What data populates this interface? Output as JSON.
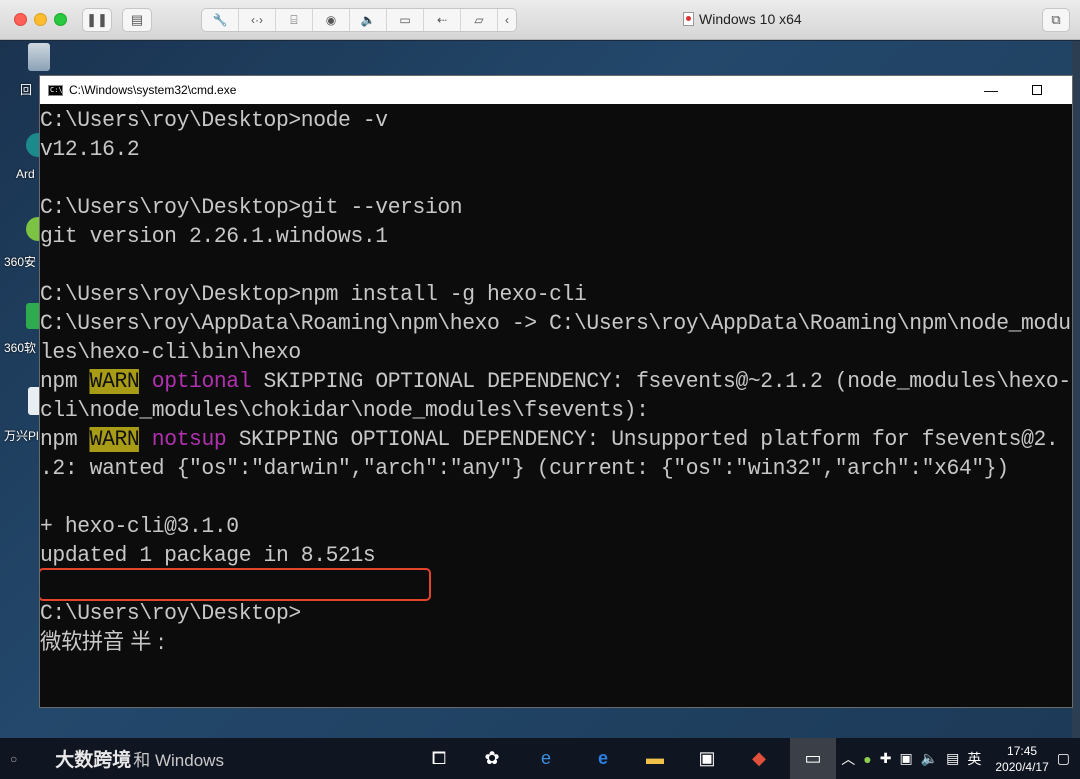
{
  "mac": {
    "title": "Windows 10 x64",
    "toolbar_icons": [
      "wrench-icon",
      "code-icon",
      "drive-icon",
      "camera-icon",
      "speaker-icon",
      "video-icon",
      "usb-icon",
      "folder-share-icon",
      "chevron-left-icon"
    ]
  },
  "desktop": {
    "icons": [
      {
        "label": "回",
        "icon": "recycle-bin-icon"
      },
      {
        "label": "Ard",
        "icon": "arduino-shortcut-icon"
      },
      {
        "label": "360安",
        "icon": "360-safe-shortcut-icon"
      },
      {
        "label": "360软",
        "icon": "360-software-shortcut-icon"
      },
      {
        "label": "万兴Pl",
        "icon": "wondershare-shortcut-icon"
      }
    ]
  },
  "cmd": {
    "title": "C:\\Windows\\system32\\cmd.exe",
    "lines": [
      "C:\\Users\\roy\\Desktop>node -v",
      "v12.16.2",
      "",
      "C:\\Users\\roy\\Desktop>git --version",
      "git version 2.26.1.windows.1",
      "",
      "C:\\Users\\roy\\Desktop>npm install -g hexo-cli",
      "C:\\Users\\roy\\AppData\\Roaming\\npm\\hexo -> C:\\Users\\roy\\AppData\\Roaming\\npm\\node_modu",
      "les\\hexo-cli\\bin\\hexo"
    ],
    "warn1": {
      "prefix": "npm ",
      "tag": "WARN",
      "level": "optional",
      "msg": " SKIPPING OPTIONAL DEPENDENCY: fsevents@~2.1.2 (node_modules\\hexo-"
    },
    "warn1_cont": "cli\\node_modules\\chokidar\\node_modules\\fsevents):",
    "warn2": {
      "prefix": "npm ",
      "tag": "WARN",
      "level": "notsup",
      "msg": " SKIPPING OPTIONAL DEPENDENCY: Unsupported platform for fsevents@2."
    },
    "warn2_cont": ".2: wanted {\"os\":\"darwin\",\"arch\":\"any\"} (current: {\"os\":\"win32\",\"arch\":\"x64\"})",
    "tail": [
      "",
      "+ hexo-cli@3.1.0",
      "updated 1 package in 8.521s",
      "",
      "C:\\Users\\roy\\Desktop>",
      "微软拼音 半 :"
    ]
  },
  "taskbar": {
    "search_brand": "大数跨境",
    "search_text": "和 Windows",
    "apps": [
      "task-view-icon",
      "app-icon",
      "ie-icon",
      "edge-icon",
      "file-explorer-icon",
      "store-icon",
      "git-icon",
      "cmd-icon"
    ],
    "ime": "英",
    "time": "17:45",
    "date": "2020/4/17"
  }
}
